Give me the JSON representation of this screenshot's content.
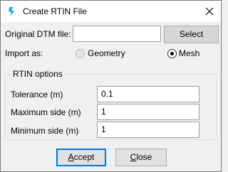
{
  "window": {
    "title": "Create RTIN File"
  },
  "dtm": {
    "label": "Original DTM file:",
    "value": "",
    "select_label": "Select"
  },
  "import": {
    "label": "Import as:",
    "options": [
      {
        "label": "Geometry",
        "selected": false
      },
      {
        "label": "Mesh",
        "selected": true
      }
    ]
  },
  "rtin": {
    "legend": "RTIN options",
    "tolerance": {
      "label": "Tolerance (m)",
      "value": "0.1"
    },
    "max_side": {
      "label": "Maximum side (m)",
      "value": "1"
    },
    "min_side": {
      "label": "Minimum side (m)",
      "value": "1"
    }
  },
  "buttons": {
    "accept": {
      "mnemonic": "A",
      "rest": "ccept"
    },
    "close": {
      "mnemonic": "C",
      "rest": "lose"
    }
  },
  "colors": {
    "accent": "#0078d7",
    "icon": "#2aa8d8"
  },
  "icons": {
    "app": "app-icon",
    "close": "close-icon"
  }
}
